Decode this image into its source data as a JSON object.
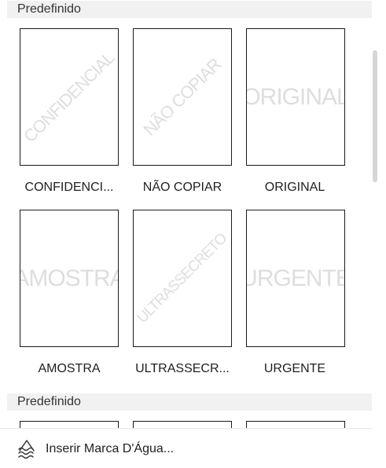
{
  "sections": [
    {
      "title": "Predefinido"
    },
    {
      "title": "Predefinido"
    }
  ],
  "watermarks": [
    {
      "label": "CONFIDENCI...",
      "watermark_text": "CONFIDENCIAL"
    },
    {
      "label": "NÃO COPIAR",
      "watermark_text": "NÃO COPIAR"
    },
    {
      "label": "ORIGINAL",
      "watermark_text": "ORIGINAL"
    },
    {
      "label": "AMOSTRA",
      "watermark_text": "AMOSTRA"
    },
    {
      "label": "ULTRASSECR...",
      "watermark_text": "ULTRASSECRETO"
    },
    {
      "label": "URGENTE",
      "watermark_text": "URGENTE"
    }
  ],
  "footer": {
    "insert_label": "Inserir Marca D'Água...",
    "icon": "watermark-icon"
  }
}
